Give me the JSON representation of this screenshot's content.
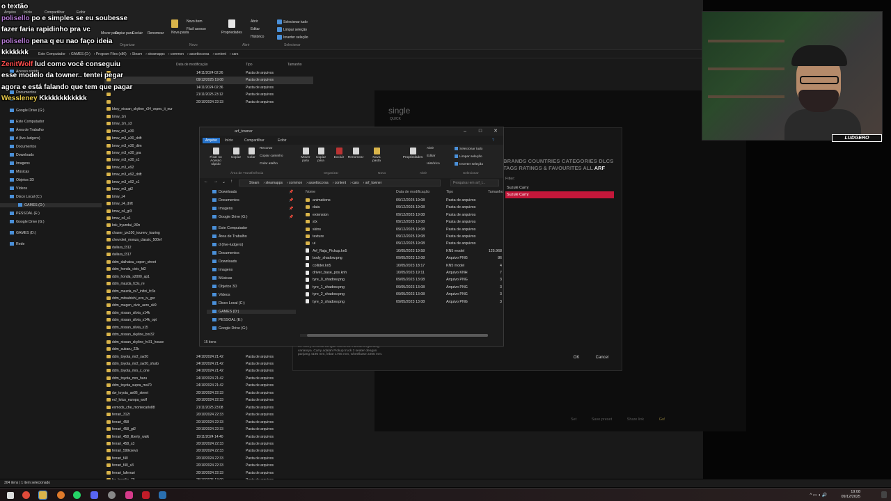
{
  "chat": [
    {
      "user": "",
      "text": "o textão",
      "color": "#ffffff"
    },
    {
      "user": "polisello",
      "text": "po e simples se eu soubesse",
      "color": "#b77bd6"
    },
    {
      "user": "",
      "text": "fazer faria rapidinho pra vc",
      "color": "#ffffff"
    },
    {
      "user": "polisello",
      "text": "pena q eu nao faço ideia",
      "color": "#b77bd6"
    },
    {
      "user": "",
      "text": "kkkkkkk",
      "color": "#ffffff"
    },
    {
      "user": "ZenitWolf",
      "text": "lud como você conseguiu",
      "color": "#ff4d4d"
    },
    {
      "user": "",
      "text": "esse modelo da towner.. tentei pegar",
      "color": "#ffffff"
    },
    {
      "user": "",
      "text": "agora e está falando que tem que pagar",
      "color": "#ffffff"
    },
    {
      "user": "Wessleney",
      "text": "Kkkkkkkkkkkk",
      "color": "#e6c84a"
    }
  ],
  "bg_explorer": {
    "ribbon_tabs": [
      "Arquivo",
      "Início",
      "Compartilhar",
      "Exibir"
    ],
    "ribbon": {
      "copy": "Copiar",
      "paste": "Colar",
      "cut": "Recortar",
      "copy_path": "Copiar caminho",
      "paste_shortcut": "Colar atalho",
      "move_to": "Mover para",
      "copy_to": "Copiar para",
      "delete": "Excluir",
      "rename": "Renomear",
      "new_folder": "Nova pasta",
      "new_item": "Novo item",
      "easy_access": "Fácil acesso",
      "properties": "Propriedades",
      "open": "Abrir",
      "edit": "Editar",
      "history": "Histórico",
      "select_all": "Selecionar tudo",
      "select_none": "Limpar seleção",
      "invert_selection": "Inverter seleção",
      "group_organize": "Organizar",
      "group_new": "Novo",
      "group_open": "Abrir",
      "group_select": "Selecionar"
    },
    "breadcrumb": [
      "Este Computador",
      "GAMES (D:)",
      "Program Files (x86)",
      "Steam",
      "steamapps",
      "common",
      "assettocorsa",
      "content",
      "cars"
    ],
    "columns": {
      "date": "Data de modificação",
      "type": "Tipo",
      "size": "Tamanho"
    },
    "nav": [
      {
        "label": "Acesso rápido"
      },
      {
        "label": "Documentos"
      },
      {
        "label": "Imagens"
      },
      {
        "label": "Google Drive (G:)"
      },
      {
        "label": "Este Computador"
      },
      {
        "label": "Área de Trabalho"
      },
      {
        "label": "d (live-ludgero)"
      },
      {
        "label": "Documentos"
      },
      {
        "label": "Downloads"
      },
      {
        "label": "Imagens"
      },
      {
        "label": "Músicas"
      },
      {
        "label": "Objetos 3D"
      },
      {
        "label": "Vídeos"
      },
      {
        "label": "Disco Local (C:)"
      },
      {
        "label": "GAMES (D:)"
      },
      {
        "label": "PESSOAL (E:)"
      },
      {
        "label": "Google Drive (G:)"
      },
      {
        "label": "GAMES (D:)"
      },
      {
        "label": "Rede"
      }
    ],
    "rows": [
      {
        "name": "",
        "date": "14/11/2024 02:26",
        "type": "Pasta de arquivos"
      },
      {
        "name": "",
        "date": "09/12/2025 19:08",
        "type": "Pasta de arquivos"
      },
      {
        "name": "",
        "date": "14/11/2024 02:36",
        "type": "Pasta de arquivos"
      },
      {
        "name": "",
        "date": "21/11/2025 23:12",
        "type": "Pasta de arquivos"
      },
      {
        "name": "",
        "date": "20/10/2024 22:33",
        "type": "Pasta de arquivos"
      },
      {
        "name": "bkey_nissan_skyline_r34_vspec_ii_nur",
        "date": "",
        "type": ""
      },
      {
        "name": "bmw_1m",
        "date": "",
        "type": ""
      },
      {
        "name": "bmw_1m_s3",
        "date": "",
        "type": ""
      },
      {
        "name": "bmw_m3_e30",
        "date": "",
        "type": ""
      },
      {
        "name": "bmw_m3_e30_drift",
        "date": "",
        "type": ""
      },
      {
        "name": "bmw_m3_e30_dtm",
        "date": "",
        "type": ""
      },
      {
        "name": "bmw_m3_e30_gra",
        "date": "",
        "type": ""
      },
      {
        "name": "bmw_m3_e30_s1",
        "date": "",
        "type": ""
      },
      {
        "name": "bmw_m3_e92",
        "date": "",
        "type": ""
      },
      {
        "name": "bmw_m3_e92_drift",
        "date": "",
        "type": ""
      },
      {
        "name": "bmw_m3_e92_s1",
        "date": "",
        "type": ""
      },
      {
        "name": "bmw_m3_gt2",
        "date": "",
        "type": ""
      },
      {
        "name": "bmw_z4",
        "date": "",
        "type": ""
      },
      {
        "name": "bmw_z4_drift",
        "date": "",
        "type": ""
      },
      {
        "name": "bmw_z4_gt3",
        "date": "",
        "type": ""
      },
      {
        "name": "bmw_z4_s1",
        "date": "",
        "type": ""
      },
      {
        "name": "bsk_hyundai_i30n",
        "date": "",
        "type": ""
      },
      {
        "name": "chaser_jzx100_tourerv_touring",
        "date": "",
        "type": ""
      },
      {
        "name": "chevrolet_monza_classic_500ef",
        "date": "",
        "type": ""
      },
      {
        "name": "dallara_f312",
        "date": "",
        "type": ""
      },
      {
        "name": "dallara_f317",
        "date": "",
        "type": ""
      },
      {
        "name": "ddm_daihatsu_copen_street",
        "date": "",
        "type": ""
      },
      {
        "name": "ddm_honda_civic_fd2",
        "date": "",
        "type": ""
      },
      {
        "name": "ddm_honda_s2000_ap1",
        "date": "",
        "type": ""
      },
      {
        "name": "ddm_mazda_fc3s_re",
        "date": "",
        "type": ""
      },
      {
        "name": "ddm_mazda_rx7_infini_fc3s",
        "date": "",
        "type": ""
      },
      {
        "name": "ddm_mitsubishi_evo_iv_gsr",
        "date": "",
        "type": ""
      },
      {
        "name": "ddm_mugen_civic_aero_sk9",
        "date": "",
        "type": ""
      },
      {
        "name": "ddm_nissan_silvia_s14k",
        "date": "",
        "type": ""
      },
      {
        "name": "ddm_nissan_silvia_s14k_opt",
        "date": "",
        "type": ""
      },
      {
        "name": "ddm_nissan_silvia_s15",
        "date": "",
        "type": ""
      },
      {
        "name": "ddm_nissan_skyline_bnr32",
        "date": "",
        "type": ""
      },
      {
        "name": "ddm_nissan_skyline_hr31_house",
        "date": "",
        "type": ""
      },
      {
        "name": "ddm_subaru_22b",
        "date": "",
        "type": ""
      },
      {
        "name": "ddm_toyota_mr2_sw20",
        "date": "24/10/2024 21:42",
        "type": "Pasta de arquivos"
      },
      {
        "name": "ddm_toyota_mr2_sw20_shuto",
        "date": "24/10/2024 21:42",
        "type": "Pasta de arquivos"
      },
      {
        "name": "ddm_toyota_mrs_c_one",
        "date": "24/10/2024 21:42",
        "type": "Pasta de arquivos"
      },
      {
        "name": "ddm_toyota_mrs_haru",
        "date": "24/10/2024 21:42",
        "type": "Pasta de arquivos"
      },
      {
        "name": "ddm_toyota_supra_ma70",
        "date": "24/10/2024 21:42",
        "type": "Pasta de arquivos"
      },
      {
        "name": "dw_toyota_ae86_street",
        "date": "20/10/2024 22:33",
        "type": "Pasta de arquivos"
      },
      {
        "name": "ecf_lotus_europa_wolf",
        "date": "20/10/2024 22:33",
        "type": "Pasta de arquivos"
      },
      {
        "name": "exmods_che_montecarlo88",
        "date": "21/11/2025 23:08",
        "type": "Pasta de arquivos"
      },
      {
        "name": "ferrari_312t",
        "date": "20/10/2024 22:33",
        "type": "Pasta de arquivos"
      },
      {
        "name": "ferrari_458",
        "date": "20/10/2024 22:33",
        "type": "Pasta de arquivos"
      },
      {
        "name": "ferrari_458_gt2",
        "date": "20/10/2024 22:33",
        "type": "Pasta de arquivos"
      },
      {
        "name": "ferrari_458_liberty_walk",
        "date": "15/11/2024 14:40",
        "type": "Pasta de arquivos"
      },
      {
        "name": "ferrari_458_s3",
        "date": "20/10/2024 22:33",
        "type": "Pasta de arquivos"
      },
      {
        "name": "ferrari_599xxevo",
        "date": "20/10/2024 22:33",
        "type": "Pasta de arquivos"
      },
      {
        "name": "ferrari_f40",
        "date": "20/10/2024 22:33",
        "type": "Pasta de arquivos"
      },
      {
        "name": "ferrari_f40_s3",
        "date": "20/10/2024 22:33",
        "type": "Pasta de arquivos"
      },
      {
        "name": "ferrari_laferrari",
        "date": "20/10/2024 22:33",
        "type": "Pasta de arquivos"
      },
      {
        "name": "fsr_brasilia_79",
        "date": "25/10/2025 13:09",
        "type": "Pasta de arquivos"
      }
    ],
    "status": "304 itens  |  1 item selecionado"
  },
  "game": {
    "title": "single",
    "quick": "QUICK",
    "bottom": [
      "Set",
      "Save preset",
      "Share link",
      "Go!"
    ]
  },
  "car_dialog": {
    "tabs_line1": [
      "BRANDS",
      "COUNTRIES",
      "CATEGORIES",
      "DLCS"
    ],
    "tabs_line2": [
      "TAGS",
      "RATINGS & FAVOURITES",
      "ALL"
    ],
    "active_tab": "ARF",
    "filter": "Filter:",
    "items": [
      "Suzuki Carry",
      "Suzuki Carry"
    ],
    "description": "cc. Carry tersedia dengan transmisi manual tergantung varianrya. Carry adalah Pickup truck 3 seater dengan panjang 4195 mm, lebar 1765 mm, wheelbase 2205 mm.",
    "ok": "OK",
    "cancel": "Cancel"
  },
  "fg_dialog": {
    "title": "arf_towner",
    "tabs": [
      "Arquivo",
      "Início",
      "Compartilhar",
      "Exibir"
    ],
    "ribbon": {
      "pin": "Fixar no Acesso rápido",
      "copy": "Copiar",
      "paste": "Colar",
      "cut": "Recortar",
      "copy_path": "Copiar caminho",
      "paste_shortcut": "Colar atalho",
      "move_to": "Mover para",
      "copy_to": "Copiar para",
      "delete": "Excluir",
      "rename": "Renomear",
      "new_folder": "Nova pasta",
      "properties": "Propriedades",
      "open": "Abrir",
      "edit": "Editar",
      "history": "Histórico",
      "select_all": "Selecionar tudo",
      "select_none": "Limpar seleção",
      "invert": "Inverter seleção",
      "g_clipboard": "Área de Transferência",
      "g_organize": "Organizar",
      "g_new": "Novo",
      "g_open": "Abrir",
      "g_select": "Selecionar"
    },
    "breadcrumb": [
      "Steam",
      "steamapps",
      "common",
      "assettocorsa",
      "content",
      "cars",
      "arf_towner"
    ],
    "search_placeholder": "Pesquisar em arf_t...",
    "columns": {
      "name": "Nome",
      "date": "Data de modificação",
      "type": "Tipo",
      "size": "Tamanho"
    },
    "nav": [
      {
        "label": "Downloads",
        "pin": true
      },
      {
        "label": "Documentos",
        "pin": true
      },
      {
        "label": "Imagens",
        "pin": true
      },
      {
        "label": "Google Drive (G:)",
        "pin": true
      },
      {
        "label": "Este Computador",
        "pin": false
      },
      {
        "label": "Área de Trabalho",
        "pin": false
      },
      {
        "label": "d (live-ludgero)",
        "pin": false
      },
      {
        "label": "Documentos",
        "pin": false
      },
      {
        "label": "Downloads",
        "pin": false
      },
      {
        "label": "Imagens",
        "pin": false
      },
      {
        "label": "Músicas",
        "pin": false
      },
      {
        "label": "Objetos 3D",
        "pin": false
      },
      {
        "label": "Vídeos",
        "pin": false
      },
      {
        "label": "Disco Local (C:)",
        "pin": false
      },
      {
        "label": "GAMES (D:)",
        "pin": false
      },
      {
        "label": "PESSOAL (E:)",
        "pin": false
      },
      {
        "label": "Google Drive (G:)",
        "pin": false
      }
    ],
    "rows": [
      {
        "name": "animations",
        "date": "09/12/2025 19:08",
        "type": "Pasta de arquivos",
        "size": "",
        "kind": "folder"
      },
      {
        "name": "data",
        "date": "09/12/2025 19:08",
        "type": "Pasta de arquivos",
        "size": "",
        "kind": "folder"
      },
      {
        "name": "extension",
        "date": "09/12/2025 19:08",
        "type": "Pasta de arquivos",
        "size": "",
        "kind": "folder"
      },
      {
        "name": "sfx",
        "date": "09/12/2025 19:08",
        "type": "Pasta de arquivos",
        "size": "",
        "kind": "folder"
      },
      {
        "name": "skins",
        "date": "09/12/2025 19:08",
        "type": "Pasta de arquivos",
        "size": "",
        "kind": "folder"
      },
      {
        "name": "texture",
        "date": "09/12/2025 19:08",
        "type": "Pasta de arquivos",
        "size": "",
        "kind": "folder"
      },
      {
        "name": "ui",
        "date": "09/12/2025 19:08",
        "type": "Pasta de arquivos",
        "size": "",
        "kind": "folder"
      },
      {
        "name": "Arf_Raja_Pickup.kn5",
        "date": "10/05/2023 19:58",
        "type": "KN5 model",
        "size": "125.968",
        "kind": "file"
      },
      {
        "name": "body_shadow.png",
        "date": "09/05/2023 13:08",
        "type": "Arquivo PNG",
        "size": "86",
        "kind": "file"
      },
      {
        "name": "collider.kn5",
        "date": "10/05/2023 18:17",
        "type": "KN5 model",
        "size": "4",
        "kind": "file"
      },
      {
        "name": "driver_base_pos.knh",
        "date": "10/05/2023 19:11",
        "type": "Arquivo KNH",
        "size": "7",
        "kind": "file"
      },
      {
        "name": "tyre_0_shadow.png",
        "date": "09/05/2023 13:08",
        "type": "Arquivo PNG",
        "size": "3",
        "kind": "file"
      },
      {
        "name": "tyre_1_shadow.png",
        "date": "09/05/2023 13:08",
        "type": "Arquivo PNG",
        "size": "3",
        "kind": "file"
      },
      {
        "name": "tyre_2_shadow.png",
        "date": "09/05/2023 13:08",
        "type": "Arquivo PNG",
        "size": "3",
        "kind": "file"
      },
      {
        "name": "tyre_3_shadow.png",
        "date": "09/05/2023 13:08",
        "type": "Arquivo PNG",
        "size": "3",
        "kind": "file"
      }
    ],
    "status": "15 itens"
  },
  "webcam": {
    "logo": "LUDGERO"
  },
  "taskbar": {
    "time": "19:08",
    "date": "09/12/2025"
  }
}
